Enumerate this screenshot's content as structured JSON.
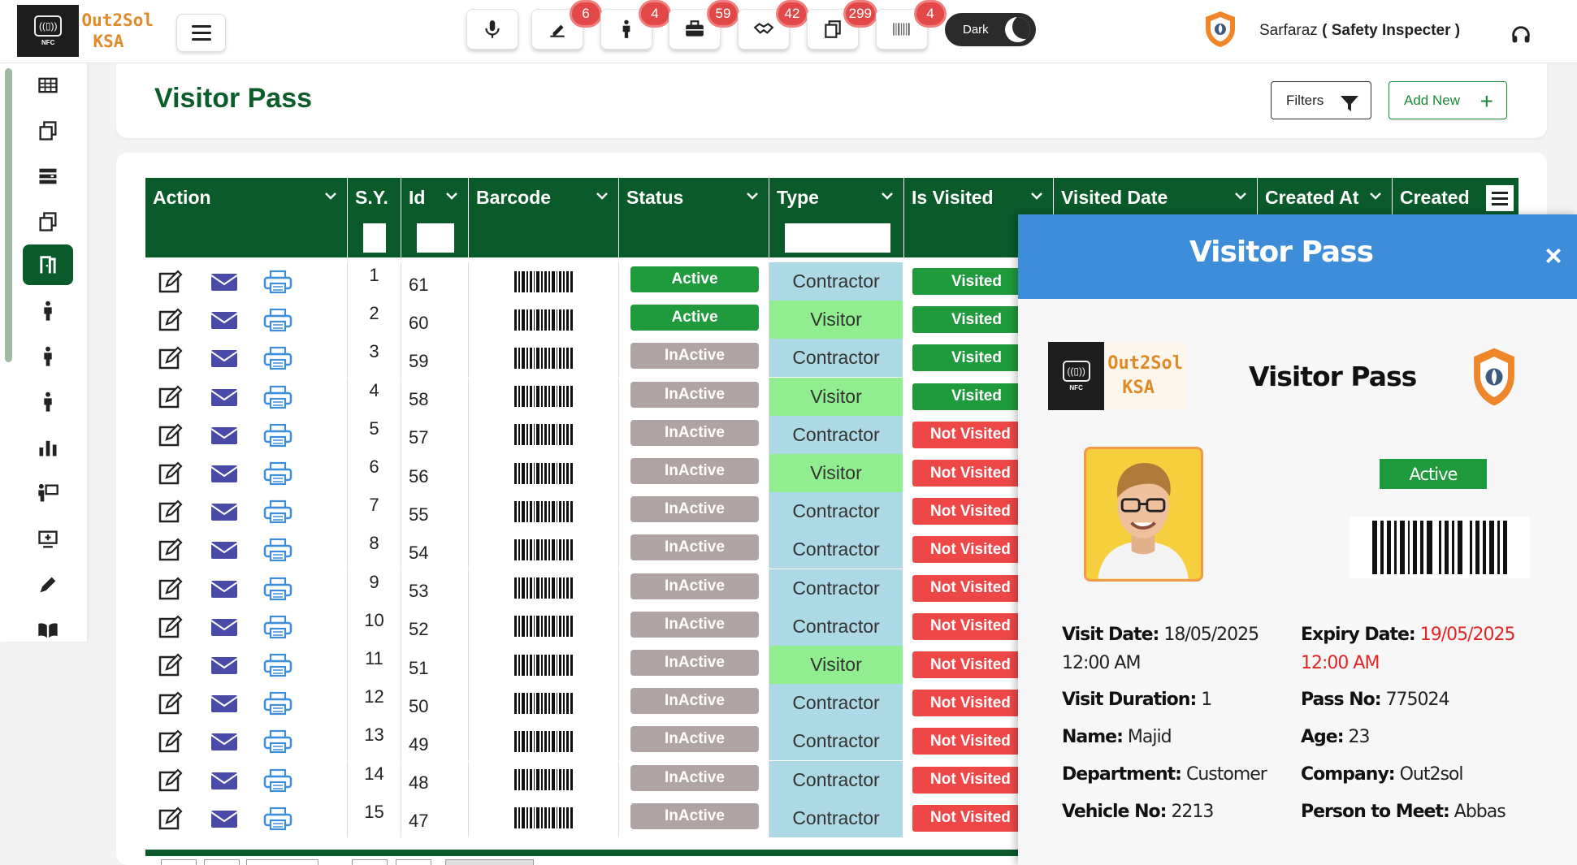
{
  "brand": {
    "line1": "Out2Sol",
    "line2": "KSA",
    "nfc": "NFC"
  },
  "toolbar": {
    "badges": [
      {
        "icon": "pen-icon",
        "count": "6"
      },
      {
        "icon": "person-icon",
        "count": "4"
      },
      {
        "icon": "briefcase-icon",
        "count": "59"
      },
      {
        "icon": "handshake-icon",
        "count": "42"
      },
      {
        "icon": "copy-icon",
        "count": "299"
      },
      {
        "icon": "barcode-icon",
        "count": "4"
      }
    ],
    "dark_label": "Dark"
  },
  "user": {
    "name": "Sarfaraz",
    "role": "( Safety Inspecter )"
  },
  "page": {
    "title": "Visitor Pass",
    "filters_label": "Filters",
    "add_new_label": "Add New",
    "add_new_icon": "+"
  },
  "table": {
    "columns": [
      "Action",
      "S.Y.",
      "Id",
      "Barcode",
      "Status",
      "Type",
      "Is Visited",
      "Visited Date",
      "Created At",
      "Created"
    ],
    "rows": [
      {
        "sn": "1",
        "id": "61",
        "status": "Active",
        "type": "Contractor",
        "visited": "Visited"
      },
      {
        "sn": "2",
        "id": "60",
        "status": "Active",
        "type": "Visitor",
        "visited": "Visited"
      },
      {
        "sn": "3",
        "id": "59",
        "status": "InActive",
        "type": "Contractor",
        "visited": "Visited"
      },
      {
        "sn": "4",
        "id": "58",
        "status": "InActive",
        "type": "Visitor",
        "visited": "Visited"
      },
      {
        "sn": "5",
        "id": "57",
        "status": "InActive",
        "type": "Contractor",
        "visited": "Not Visited"
      },
      {
        "sn": "6",
        "id": "56",
        "status": "InActive",
        "type": "Visitor",
        "visited": "Not Visited"
      },
      {
        "sn": "7",
        "id": "55",
        "status": "InActive",
        "type": "Contractor",
        "visited": "Not Visited"
      },
      {
        "sn": "8",
        "id": "54",
        "status": "InActive",
        "type": "Contractor",
        "visited": "Not Visited"
      },
      {
        "sn": "9",
        "id": "53",
        "status": "InActive",
        "type": "Contractor",
        "visited": "Not Visited"
      },
      {
        "sn": "10",
        "id": "52",
        "status": "InActive",
        "type": "Contractor",
        "visited": "Not Visited"
      },
      {
        "sn": "11",
        "id": "51",
        "status": "InActive",
        "type": "Visitor",
        "visited": "Not Visited"
      },
      {
        "sn": "12",
        "id": "50",
        "status": "InActive",
        "type": "Contractor",
        "visited": "Not Visited"
      },
      {
        "sn": "13",
        "id": "49",
        "status": "InActive",
        "type": "Contractor",
        "visited": "Not Visited"
      },
      {
        "sn": "14",
        "id": "48",
        "status": "InActive",
        "type": "Contractor",
        "visited": "Not Visited"
      },
      {
        "sn": "15",
        "id": "47",
        "status": "InActive",
        "type": "Contractor",
        "visited": "Not Visited"
      }
    ]
  },
  "modal": {
    "title": "Visitor Pass",
    "close": "×",
    "pass_label": "Visitor Pass",
    "status": "Active",
    "visit_date_label": "Visit Date:",
    "visit_date": "18/05/2025",
    "visit_time": "12:00 AM",
    "expiry_date_label": "Expiry Date:",
    "expiry_date": "19/05/2025",
    "expiry_time": "12:00 AM",
    "duration_label": "Visit Duration:",
    "duration": "1",
    "pass_no_label": "Pass No:",
    "pass_no": "775024",
    "name_label": "Name:",
    "name": "Majid",
    "age_label": "Age:",
    "age": "23",
    "department_label": "Department:",
    "department": "Customer",
    "company_label": "Company:",
    "company": "Out2sol",
    "vehicle_label": "Vehicle No:",
    "vehicle": "2213",
    "meet_label": "Person to Meet:",
    "meet": "Abbas"
  },
  "colors": {
    "primary_green": "#0a5a2a",
    "modal_blue": "#3d8ddb",
    "active_green": "#1f9a3c",
    "inactive_grey": "#b0a3a3",
    "not_visited_red": "#ee4747",
    "contractor_blue": "#add8e6",
    "visitor_green": "#90ee90"
  }
}
